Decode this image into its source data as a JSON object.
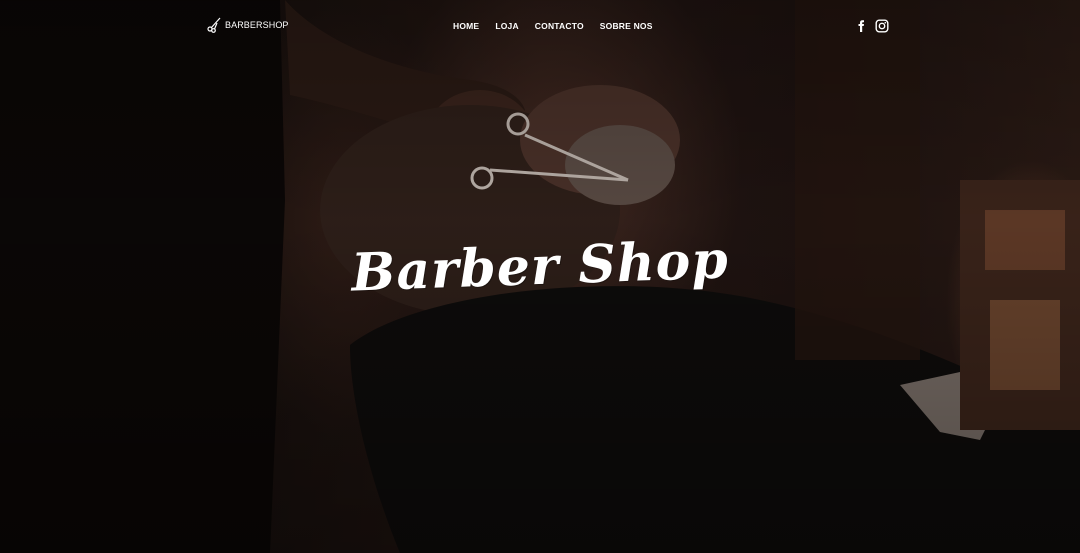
{
  "brand": {
    "name": "BARBERSHOP",
    "icon": "scissors-icon"
  },
  "nav": {
    "items": [
      {
        "label": "HOME"
      },
      {
        "label": "LOJA"
      },
      {
        "label": "CONTACTO"
      },
      {
        "label": "SOBRE NOS"
      }
    ]
  },
  "social": {
    "icons": [
      "facebook-icon",
      "instagram-icon"
    ]
  },
  "hero": {
    "title": "Barber Shop"
  },
  "colors": {
    "text": "#ffffff",
    "background": "#120b09"
  }
}
